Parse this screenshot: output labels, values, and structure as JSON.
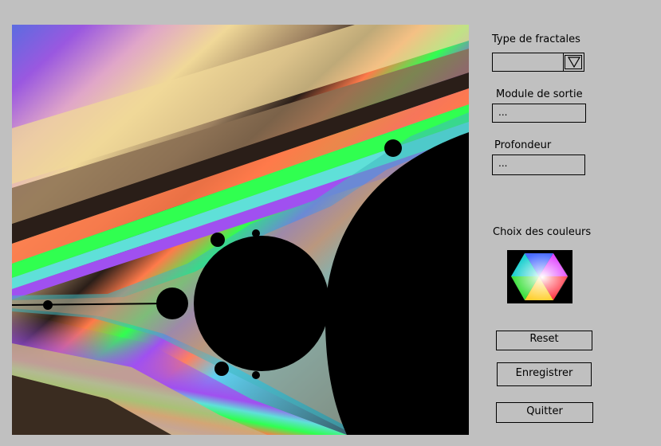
{
  "controls": {
    "fractal_type_label": "Type de fractales",
    "fractal_type_value": "",
    "exit_modulus_label": "Module de sortie",
    "exit_modulus_value": "...",
    "depth_label": "Profondeur",
    "depth_value": "...",
    "colors_label": "Choix des couleurs"
  },
  "buttons": {
    "reset": "Reset",
    "save": "Enregistrer",
    "quit": "Quitter"
  },
  "icons": {
    "combo_arrow": "triangle-down-icon",
    "palette": "color-palette-icon"
  },
  "colors": {
    "background": "#c0c0c0",
    "fractal_interior": "#000000"
  }
}
